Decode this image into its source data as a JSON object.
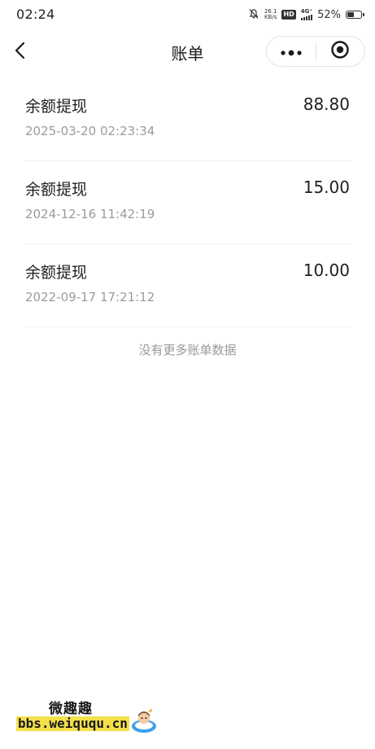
{
  "status_bar": {
    "time": "02:24",
    "net_speed_value": "26.1",
    "net_speed_unit": "KB/s",
    "hd_label": "HD",
    "network_type": "4G⁺",
    "battery_percent": "52%",
    "battery_level": 0.52
  },
  "navbar": {
    "title": "账单",
    "back_icon": "chevron-left-icon",
    "more_icon": "more-dots-icon",
    "close_icon": "target-circle-icon"
  },
  "bills": [
    {
      "name": "余额提现",
      "amount": "88.80",
      "time": "2025-03-20 02:23:34"
    },
    {
      "name": "余额提现",
      "amount": "15.00",
      "time": "2024-12-16 11:42:19"
    },
    {
      "name": "余额提现",
      "amount": "10.00",
      "time": "2022-09-17 17:21:12"
    }
  ],
  "footer_text": "没有更多账单数据",
  "watermark": {
    "top_text": "微趣趣",
    "bottom_text": "bbs.weiququ.cn"
  },
  "colors": {
    "text_primary": "#1f1f1f",
    "text_secondary": "#9b9b9b",
    "divider": "#efefef",
    "watermark_highlight": "#f3e04a"
  }
}
